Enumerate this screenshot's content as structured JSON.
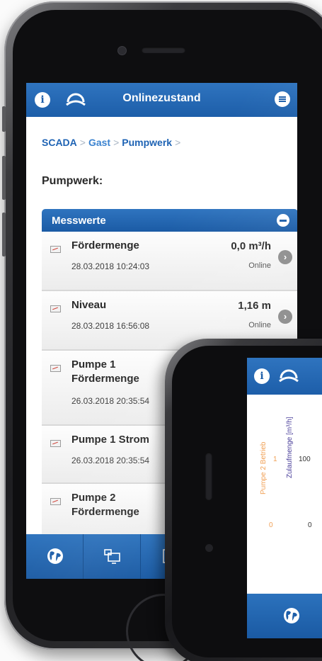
{
  "colors": {
    "brand_blue": "#1d5ea9",
    "link_blue": "#1e63b4",
    "orange": "#f0a055",
    "purple": "#4a3f9a"
  },
  "main_screen": {
    "header": {
      "info_icon": "info-icon",
      "logo_icon": "logo-icon",
      "title": "Onlinezustand",
      "menu_icon": "menu-icon"
    },
    "breadcrumb": [
      {
        "label": "SCADA"
      },
      {
        "label": "Gast"
      },
      {
        "label": "Pumpwerk"
      }
    ],
    "breadcrumb_sep": ">",
    "page_title": "Pumpwerk:",
    "section": {
      "title": "Messwerte",
      "toggle_icon": "minus-icon"
    },
    "rows": [
      {
        "name": "Fördermenge",
        "timestamp": "28.03.2018 10:24:03",
        "value": "0,0 m³/h",
        "status": "Online"
      },
      {
        "name": "Niveau",
        "timestamp": "28.03.2018 16:56:08",
        "value": "1,16 m",
        "status": "Online"
      },
      {
        "name": "Pumpe 1 Fördermenge",
        "timestamp": "26.03.2018 20:35:54",
        "value": "",
        "status": ""
      },
      {
        "name": "Pumpe 1 Strom",
        "timestamp": "26.03.2018 20:35:54",
        "value": "",
        "status": ""
      },
      {
        "name": "Pumpe 2 Fördermenge",
        "timestamp": "",
        "value": "",
        "status": ""
      }
    ],
    "tabs": [
      {
        "icon": "globe-icon"
      },
      {
        "icon": "monitor-icon"
      },
      {
        "icon": "window-icon"
      }
    ]
  },
  "second_screen": {
    "header": {
      "info_icon": "info-icon",
      "logo_icon": "logo-icon"
    },
    "chart_axes": {
      "left_axis_label": "Pumpe 2 Betrieb",
      "left_ticks": [
        "1",
        "0"
      ],
      "right_axis_label": "Zulaufmenge [m³/h]",
      "right_ticks": [
        "100",
        "0"
      ]
    },
    "tab_icon": "globe-icon"
  }
}
